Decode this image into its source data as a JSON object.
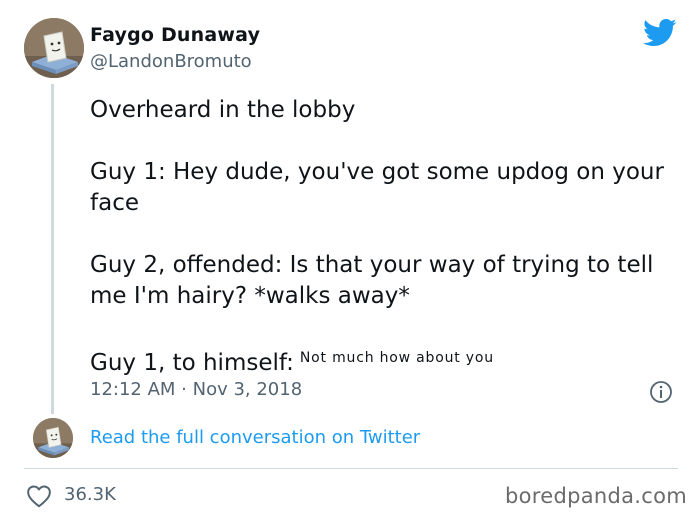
{
  "author": {
    "display_name": "Faygo Dunaway",
    "handle": "@LandonBromuto"
  },
  "tweet": {
    "paragraphs": [
      "Overheard in the lobby",
      "Guy 1: Hey dude, you've got some updog on your face",
      "Guy 2, offended: Is that your way of trying to tell me I'm hairy? *walks away*"
    ],
    "last_line_prefix": "Guy 1, to himself:",
    "last_line_small": "Not much how about you",
    "timestamp": "12:12 AM · Nov 3, 2018"
  },
  "footer": {
    "read_link": "Read the full conversation on Twitter",
    "like_count": "36.3K"
  },
  "watermark": "boredpanda.com",
  "colors": {
    "twitter_blue": "#1d9bf0",
    "text": "#0f1419",
    "muted": "#536471"
  },
  "icons": [
    "twitter-bird-icon",
    "info-icon",
    "heart-icon"
  ]
}
